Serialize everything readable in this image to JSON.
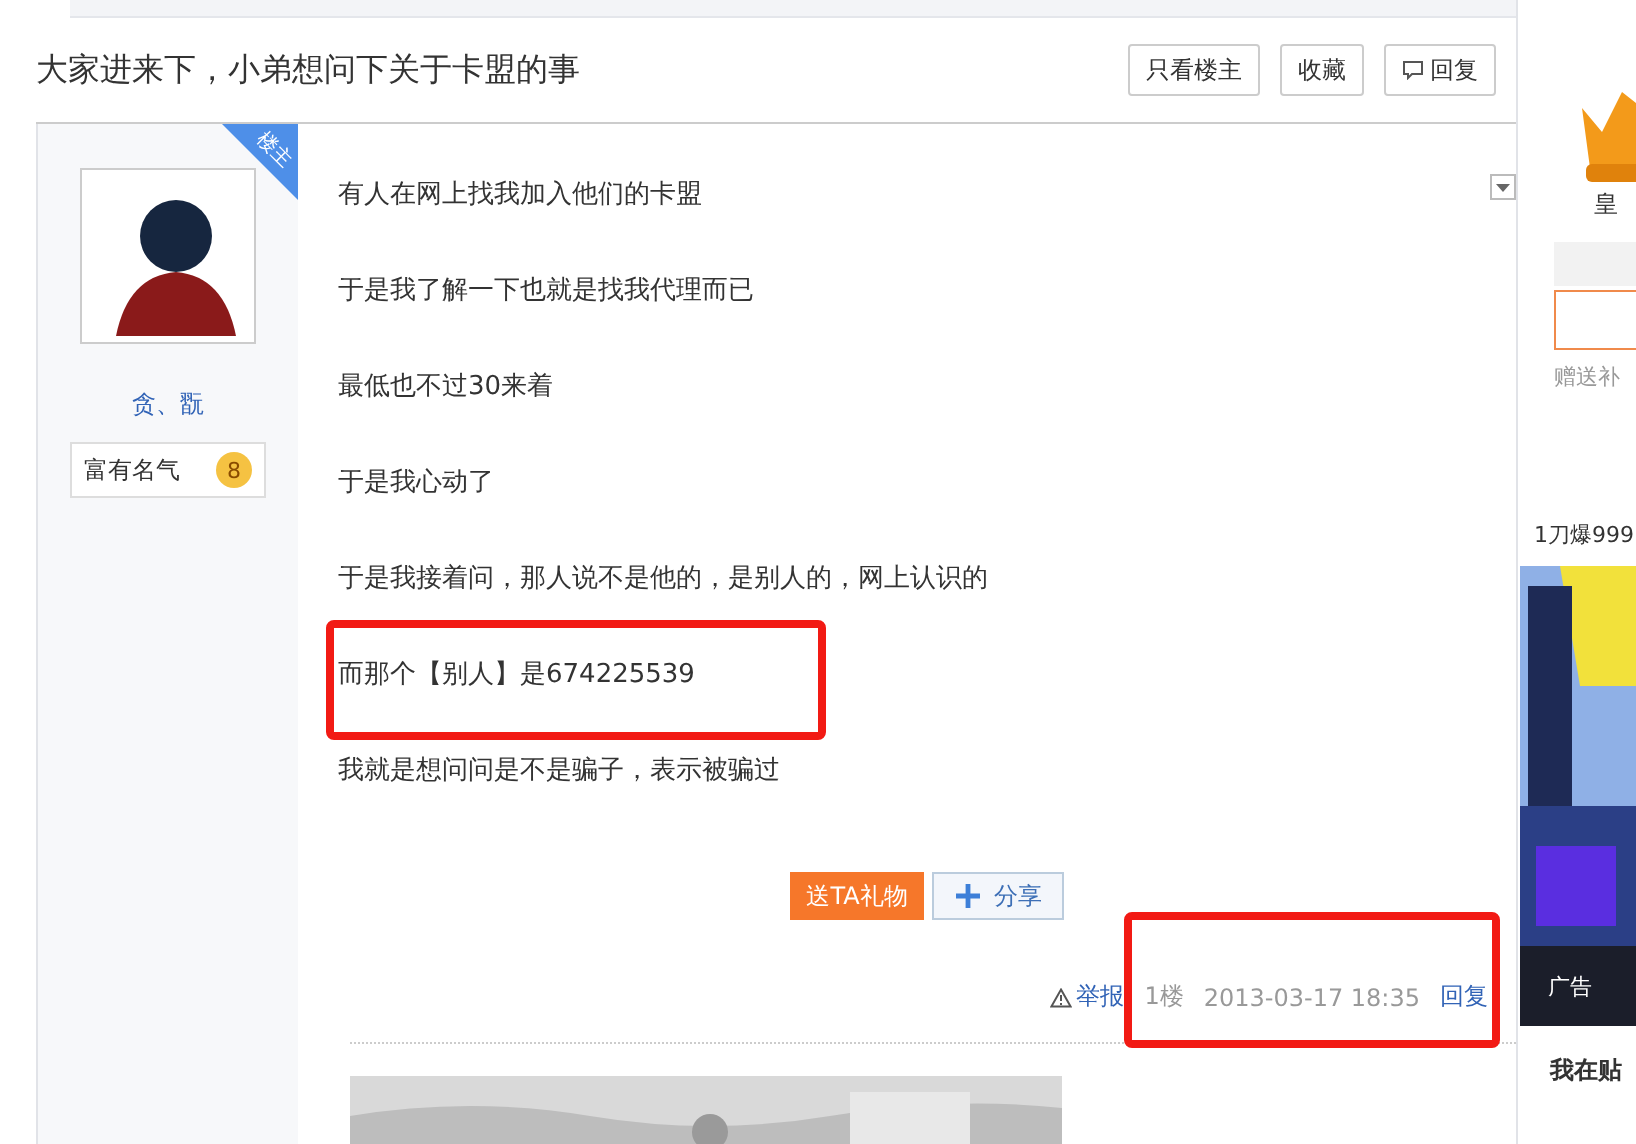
{
  "thread": {
    "title": "大家进来下，小弟想问下关于卡盟的事",
    "buttons": [
      "只看楼主",
      "收藏",
      "回复"
    ]
  },
  "post": {
    "author": {
      "name": "贪、翫",
      "badge": "楼主",
      "title": "富有名气",
      "level": "8"
    },
    "lines": [
      {
        "text": "有人在网上找我加入他们的卡盟",
        "highlighted": false
      },
      {
        "text": "于是我了解一下也就是找我代理而已",
        "highlighted": false
      },
      {
        "text": "最低也不过30来着",
        "highlighted": false
      },
      {
        "text": "于是我心动了",
        "highlighted": false
      },
      {
        "text": "于是我接着问，那人说不是他的，是别人的，网上认识的",
        "highlighted": false
      },
      {
        "text": "而那个【别人】是674225539",
        "highlighted": true
      },
      {
        "text": "我就是想问问是不是骗子，表示被骗过",
        "highlighted": false
      }
    ],
    "gift_button": "送TA礼物",
    "share_button": "分享",
    "footer": {
      "report": "举报",
      "floor": "1楼",
      "time": "2013-03-17 18:35",
      "reply": "回复",
      "highlighted": true
    }
  },
  "sidebar": {
    "crown_label": "皇",
    "hint": "赠送补",
    "ad_title": "1刀爆999",
    "ad_tag": "广告",
    "bottom_text": "我在贴"
  }
}
